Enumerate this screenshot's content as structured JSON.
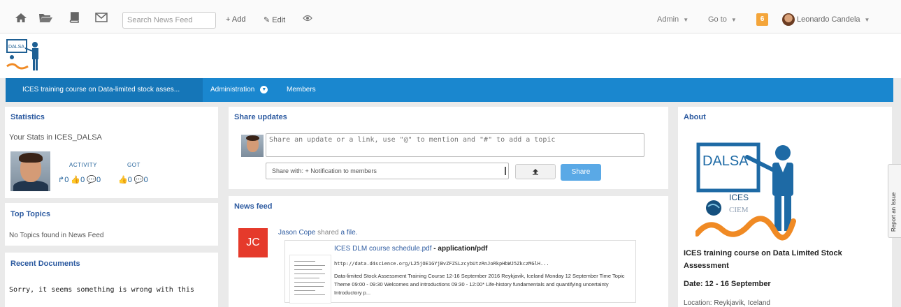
{
  "topbar": {
    "icons": [
      "home-icon",
      "folder-icon",
      "book-icon",
      "envelope-icon"
    ],
    "search_placeholder": "Search News Feed",
    "add_label": "+ Add",
    "edit_label": "Edit",
    "eye_icon": "eye-icon",
    "admin_label": "Admin",
    "goto_label": "Go to",
    "notification_count": "6",
    "user_name": "Leonardo Candela"
  },
  "nav": {
    "active_label": "ICES training course on Data-limited stock asses...",
    "administration_label": "Administration",
    "members_label": "Members"
  },
  "statistics": {
    "title": "Statistics",
    "subtitle": "Your Stats in ICES_DALSA",
    "activity_label": "ACTIVITY",
    "got_label": "GOT",
    "activity_counts": "↱0 👍0 💬0",
    "got_counts": "👍0 💬0"
  },
  "top_topics": {
    "title": "Top Topics",
    "text": "No Topics found in News Feed"
  },
  "recent_documents": {
    "title": "Recent Documents",
    "text": "Sorry, it seems something is wrong with this"
  },
  "share": {
    "title": "Share updates",
    "placeholder": "Share an update or a link, use \"@\" to mention and \"#\" to add a topic",
    "share_with": "Share with: + Notification to members",
    "share_button": "Share"
  },
  "news_feed": {
    "title": "News feed",
    "post": {
      "avatar_initials": "JC",
      "author": "Jason Cope",
      "verb": "shared",
      "object": "a file.",
      "file_name": "ICES DLM course schedule.pdf",
      "file_type": " - application/pdf",
      "url": "http://data.d4science.org/L25jOE1GYjBvZFZSLzcybUtzRnJoRkpHbWJ5ZkczMGlH...",
      "description": "Data-limited Stock Assessment Training Course 12-16 September 2016 Reykjavik, Iceland Monday 12 September Time Topic Theme 09:00 - 09:30 Welcomes and introductions 09:30 - 12:00* Life-history fundamentals and quantifying uncertainty Introductory p..."
    }
  },
  "about": {
    "title": "About",
    "logo_text": "DALSA",
    "logo_sub1": "ICES",
    "logo_sub2": "CIEM",
    "course": "ICES training course on Data Limited Stock Assessment",
    "date": "Date: 12 - 16 September",
    "location": "Location: Reykjavik, Iceland"
  },
  "report_issue": "Report an Issue",
  "colors": {
    "nav_blue": "#1a87cf",
    "nav_active": "#1576b8",
    "link_blue": "#2c5aa0",
    "notification_orange": "#f4a53a",
    "avatar_red": "#e53a2b",
    "share_button": "#5aa9e6"
  }
}
